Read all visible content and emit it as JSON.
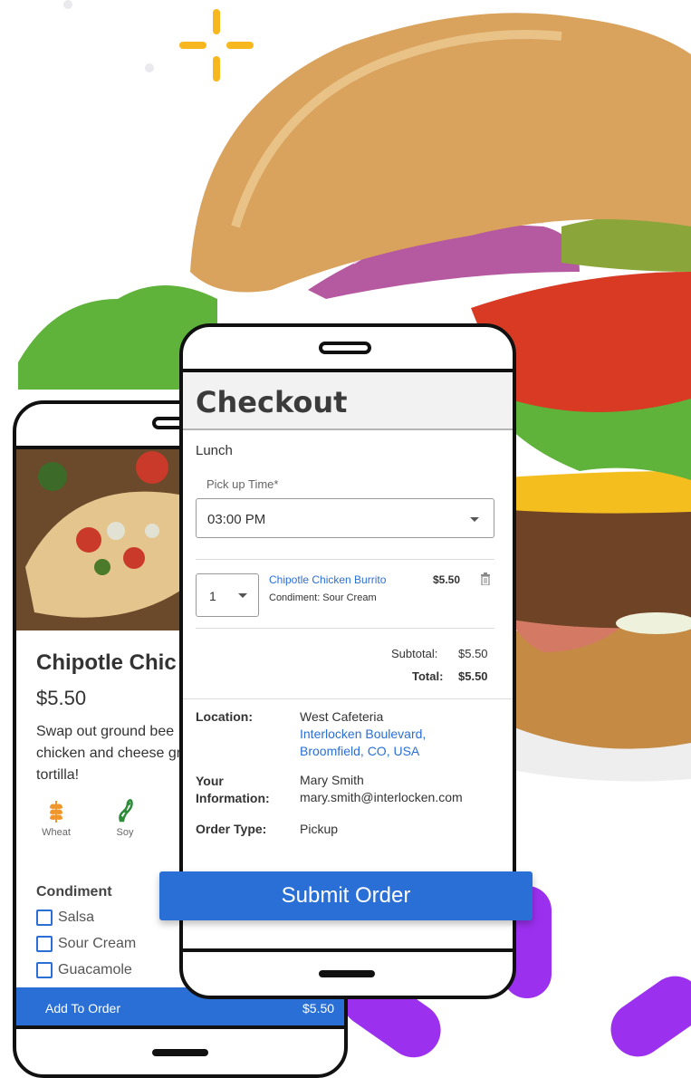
{
  "colors": {
    "accent": "#2a6fd6",
    "purple": "#9b30ef",
    "spark": "#f7b81f"
  },
  "menu_item": {
    "title": "Chipotle Chic",
    "price": "$5.50",
    "description": "Swap out ground bee chicken and cheese grain tortilla!",
    "allergens": [
      {
        "label": "Wheat",
        "icon": "wheat-icon"
      },
      {
        "label": "Soy",
        "icon": "soy-icon"
      }
    ],
    "condiment_heading": "Condiment",
    "condiments": [
      "Salsa",
      "Sour Cream",
      "Guacamole"
    ],
    "add_button_label": "Add To Order",
    "add_button_price": "$5.50"
  },
  "checkout": {
    "title": "Checkout",
    "meal": "Lunch",
    "pickup_label": "Pick up Time*",
    "pickup_value": "03:00 PM",
    "item": {
      "qty": "1",
      "name": "Chipotle Chicken Burrito",
      "price": "$5.50",
      "condiment": "Condiment: Sour Cream"
    },
    "subtotal_label": "Subtotal:",
    "subtotal_value": "$5.50",
    "total_label": "Total:",
    "total_value": "$5.50",
    "location_label": "Location:",
    "location_name": "West Cafeteria",
    "location_address_1": "Interlocken Boulevard,",
    "location_address_2": "Broomfield, CO, USA",
    "info_label_1": "Your",
    "info_label_2": "Information:",
    "info_name": "Mary Smith",
    "info_email": "mary.smith@interlocken.com",
    "order_type_label": "Order Type:",
    "order_type_value": "Pickup",
    "submit_label": "Submit Order"
  }
}
